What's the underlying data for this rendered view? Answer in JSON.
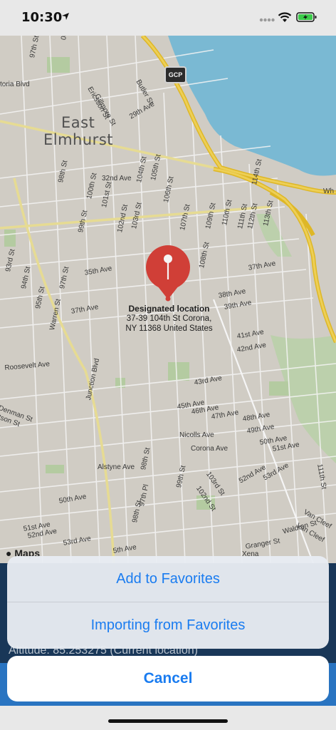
{
  "status_bar": {
    "time": "10:30"
  },
  "map": {
    "neighborhood": [
      "East",
      "Elmhurst"
    ],
    "highway_shield": "GCP",
    "attribution": "Maps",
    "pin": {
      "title": "Designated location",
      "address_line1": "37-39 104th St Corona,",
      "address_line2": "NY  11368 United States",
      "color": "#d9423a"
    },
    "streets": [
      {
        "text": "toria Blvd"
      },
      {
        "text": "97th St"
      },
      {
        "text": "00th St"
      },
      {
        "text": "Ericsson St"
      },
      {
        "text": "Gillmore St"
      },
      {
        "text": "Butler St"
      },
      {
        "text": "29th Ave"
      },
      {
        "text": "32nd Ave"
      },
      {
        "text": "98th St"
      },
      {
        "text": "100th St"
      },
      {
        "text": "104th St"
      },
      {
        "text": "105th St"
      },
      {
        "text": "106th St"
      },
      {
        "text": "101st St"
      },
      {
        "text": "99th St"
      },
      {
        "text": "102nd St"
      },
      {
        "text": "103rd St"
      },
      {
        "text": "107th St"
      },
      {
        "text": "108th St"
      },
      {
        "text": "109th St"
      },
      {
        "text": "110th St"
      },
      {
        "text": "111th St"
      },
      {
        "text": "112th St"
      },
      {
        "text": "113th St"
      },
      {
        "text": "114th St"
      },
      {
        "text": "35th Ave"
      },
      {
        "text": "37th Ave"
      },
      {
        "text": "37th Ave"
      },
      {
        "text": "38th Ave"
      },
      {
        "text": "39th Ave"
      },
      {
        "text": "41st Ave"
      },
      {
        "text": "42nd Ave"
      },
      {
        "text": "93rd St"
      },
      {
        "text": "94th St"
      },
      {
        "text": "95th St"
      },
      {
        "text": "97th St"
      },
      {
        "text": "Warren St"
      },
      {
        "text": "Roosevelt Ave"
      },
      {
        "text": "Junction Blvd"
      },
      {
        "text": "43rd Ave"
      },
      {
        "text": "45th Ave"
      },
      {
        "text": "46th Ave"
      },
      {
        "text": "47th Ave"
      },
      {
        "text": "48th Ave"
      },
      {
        "text": "49th Ave"
      },
      {
        "text": "50th Ave"
      },
      {
        "text": "51st Ave"
      },
      {
        "text": "Nicolls Ave"
      },
      {
        "text": "Corona Ave"
      },
      {
        "text": "Denman St"
      },
      {
        "text": "tson St"
      },
      {
        "text": "Alstyne Ave"
      },
      {
        "text": "98th St"
      },
      {
        "text": "99th St"
      },
      {
        "text": "103rd St"
      },
      {
        "text": "102nd St"
      },
      {
        "text": "52nd Ave"
      },
      {
        "text": "53rd Ave"
      },
      {
        "text": "50th Ave"
      },
      {
        "text": "97th Pl"
      },
      {
        "text": "98th St"
      },
      {
        "text": "51st Ave"
      },
      {
        "text": "52nd Ave"
      },
      {
        "text": "53rd Ave"
      },
      {
        "text": "5th Ave"
      },
      {
        "text": "Van Cleef"
      },
      {
        "text": "Van Cleef"
      },
      {
        "text": "Waldron St"
      },
      {
        "text": "Granger St"
      },
      {
        "text": "Xena"
      },
      {
        "text": "Wh"
      },
      {
        "text": "111th St"
      }
    ]
  },
  "location_info": {
    "altitude": "Altitude: 85.253275 (Current location)"
  },
  "action_sheet": {
    "add_favorites": "Add to Favorites",
    "import_favorites": "Importing from Favorites",
    "cancel": "Cancel",
    "accent_color": "#1a7cf0"
  }
}
